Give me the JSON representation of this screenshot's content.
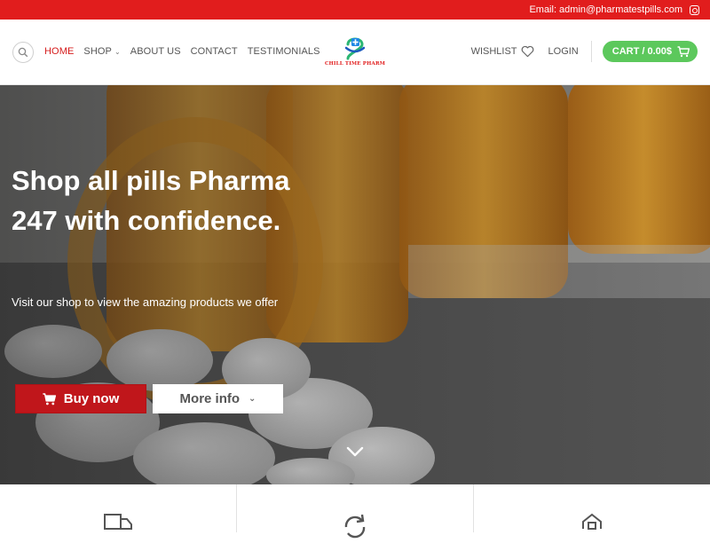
{
  "topbar": {
    "email": "Email: admin@pharmatestpills.com",
    "social_icon": "instagram-icon"
  },
  "header": {
    "search_icon": "search-icon",
    "nav": [
      {
        "label": "HOME",
        "active": true
      },
      {
        "label": "SHOP",
        "has_dropdown": true
      },
      {
        "label": "ABOUT US"
      },
      {
        "label": "CONTACT"
      },
      {
        "label": "TESTIMONIALS"
      }
    ],
    "logo_text": "CHILL TIME PHARM",
    "wishlist_label": "WISHLIST",
    "login_label": "LOGIN",
    "cart_label": "CART / 0.00$"
  },
  "hero": {
    "title": "Shop all pills Pharma 247 with confidence.",
    "subtitle": "Visit our shop to view the amazing products we offer",
    "buy_label": "Buy now",
    "more_label": "More info"
  },
  "features": [
    {
      "icon": "truck-icon"
    },
    {
      "icon": "refresh-icon"
    },
    {
      "icon": "home-icon"
    }
  ],
  "colors": {
    "brand_red": "#e11d1d",
    "button_red": "#c0161b",
    "cart_green": "#5cc85c",
    "active_nav": "#d61d1d"
  }
}
